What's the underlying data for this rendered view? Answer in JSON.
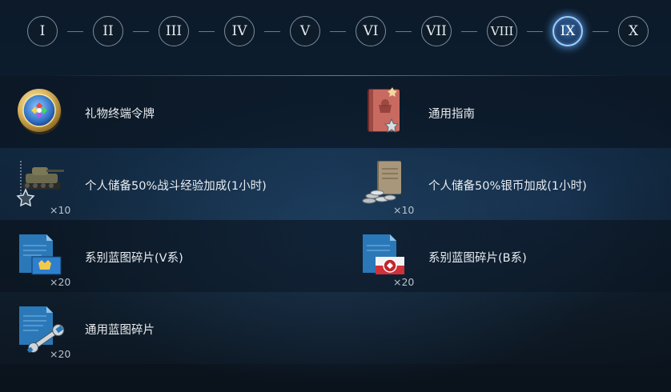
{
  "tiers": [
    {
      "label": "I"
    },
    {
      "label": "II"
    },
    {
      "label": "III"
    },
    {
      "label": "IV"
    },
    {
      "label": "V"
    },
    {
      "label": "VI"
    },
    {
      "label": "VII"
    },
    {
      "label": "VIII"
    },
    {
      "label": "IX",
      "active": true
    },
    {
      "label": "X"
    }
  ],
  "rewards": [
    {
      "label": "礼物终端令牌",
      "icon": "gift-token-medal-icon"
    },
    {
      "label": "通用指南",
      "icon": "universal-guide-book-icon"
    },
    {
      "label": "个人储备50%战斗经验加成(1小时)",
      "count": "×10",
      "icon": "combat-xp-reserve-tank-icon"
    },
    {
      "label": "个人储备50%银币加成(1小时)",
      "count": "×10",
      "icon": "credit-reserve-coins-icon"
    },
    {
      "label": "系别蓝图碎片(V系)",
      "count": "×20",
      "icon": "nation-blueprint-sweden-icon"
    },
    {
      "label": "系别蓝图碎片(B系)",
      "count": "×20",
      "icon": "nation-blueprint-poland-icon"
    },
    {
      "label": "通用蓝图碎片",
      "count": "×20",
      "icon": "universal-blueprint-wrench-icon"
    }
  ],
  "colors": {
    "active_tier_glow": "#5aa0f0",
    "tier_border": "#7d8c9c",
    "background": "#0d1f31"
  }
}
